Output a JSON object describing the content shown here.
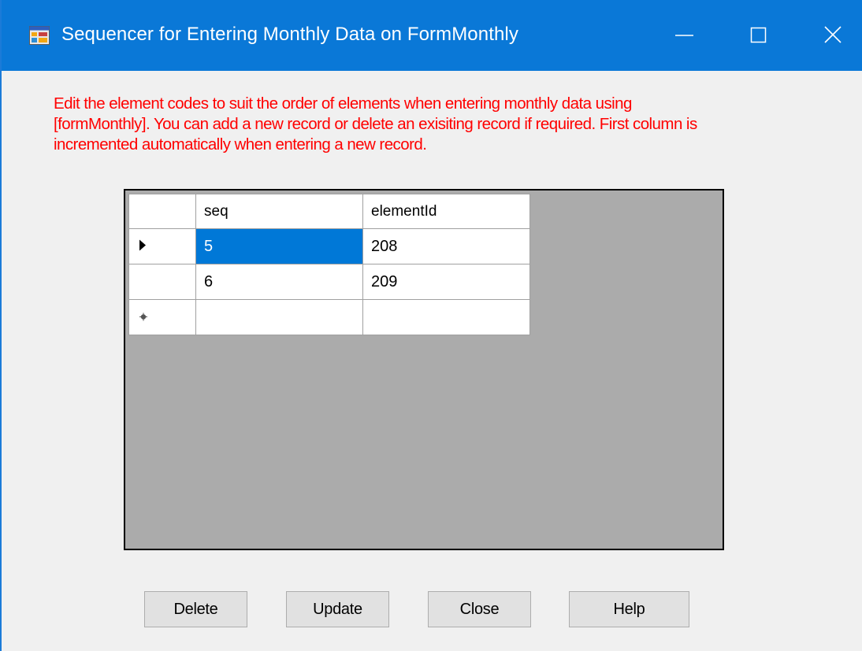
{
  "window": {
    "title": "Sequencer for Entering Monthly Data on FormMonthly",
    "icon": "form-app-icon"
  },
  "titlebar_buttons": {
    "minimize_icon": "minimize-icon",
    "maximize_icon": "maximize-icon",
    "close_icon": "close-icon"
  },
  "instructions": "Edit the element codes  to suit the order of elements when entering monthly data using\n[formMonthly]. You can add a new record or delete an exisiting record if required. First column is\nincremented automatically when entering a new record.",
  "grid": {
    "columns": [
      "seq",
      "elementId"
    ],
    "rows": [
      {
        "marker": "current-row-arrow",
        "seq": "5",
        "elementId": "208"
      },
      {
        "marker": "",
        "seq": "6",
        "elementId": "209"
      },
      {
        "marker": "new-row-asterisk",
        "seq": "",
        "elementId": ""
      }
    ],
    "selection_color": "#0078d7",
    "background_color": "#ababab"
  },
  "buttons": {
    "delete": "Delete",
    "update": "Update",
    "close": "Close",
    "help": "Help"
  },
  "colors": {
    "titlebar": "#0a78d7",
    "instruction_text": "#ff0000"
  }
}
